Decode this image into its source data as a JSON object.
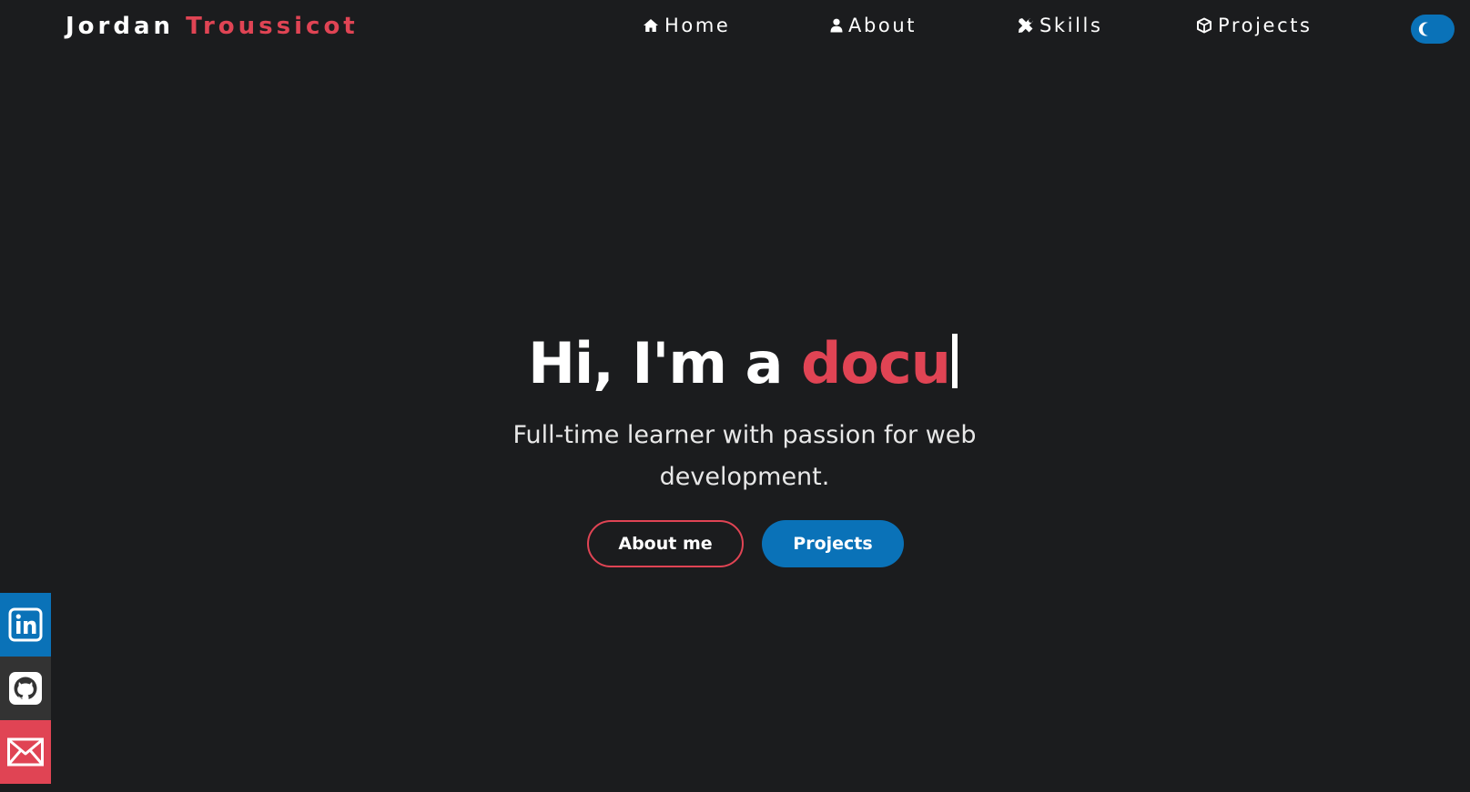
{
  "header": {
    "brand_first": "Jordan",
    "brand_last": "Troussicot",
    "nav": {
      "home": {
        "label": "Home",
        "icon": "home-icon"
      },
      "about": {
        "label": "About",
        "icon": "user-icon"
      },
      "skills": {
        "label": "Skills",
        "icon": "tools-icon"
      },
      "projects": {
        "label": "Projects",
        "icon": "cube-icon"
      }
    },
    "theme_toggle_icon": "moon-icon"
  },
  "hero": {
    "title_prefix": "Hi, I'm a ",
    "title_typed": "docu",
    "subtitle": "Full-time learner with passion for web development.",
    "about_button": "About me",
    "projects_button": "Projects"
  },
  "social": {
    "linkedin_icon": "linkedin-icon",
    "github_icon": "github-icon",
    "mail_icon": "mail-icon"
  },
  "colors": {
    "background": "#1b1c1e",
    "accent_red": "#e04454",
    "accent_blue": "#0a72b8",
    "github_bg": "#333333"
  }
}
